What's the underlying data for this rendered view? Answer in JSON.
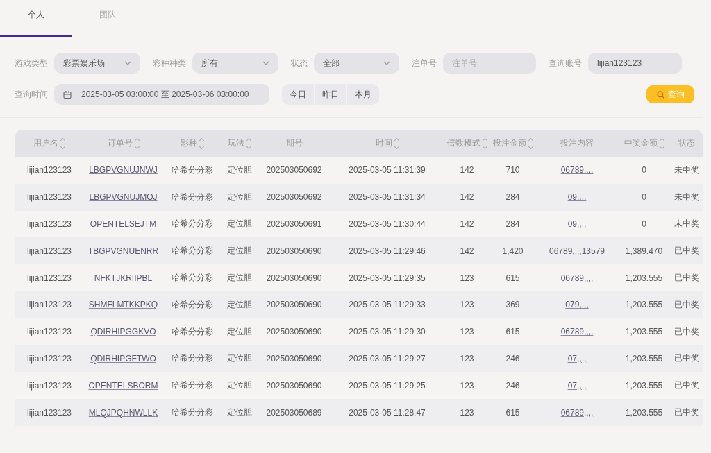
{
  "tabs": [
    {
      "label": "个人",
      "selected": true
    },
    {
      "label": "团队",
      "selected": false
    }
  ],
  "filters": [
    {
      "kind": "select",
      "label": "游戏类型",
      "value": "彩票娱乐场"
    },
    {
      "kind": "select",
      "label": "彩种种类",
      "value": "所有"
    },
    {
      "kind": "select",
      "label": "状态",
      "value": "全部"
    },
    {
      "kind": "input",
      "label": "注单号",
      "placeholder": "注单号"
    },
    {
      "kind": "input",
      "label": "查询账号",
      "value": "lijian123123"
    }
  ],
  "date_filter": {
    "label": "查询时间",
    "value": "2025-03-05 03:00:00 至 2025-03-06 03:00:00"
  },
  "quick_ranges": [
    "今日",
    "昨日",
    "本月"
  ],
  "query_button": {
    "label": "查询"
  },
  "table": {
    "columns": [
      {
        "label": "用户名",
        "sortable": true
      },
      {
        "label": "订单号",
        "sortable": true
      },
      {
        "label": "彩种",
        "sortable": true
      },
      {
        "label": "玩法",
        "sortable": true
      },
      {
        "label": "期号",
        "sortable": false
      },
      {
        "label": "时间",
        "sortable": true
      },
      {
        "label": "倍数模式",
        "sortable": true
      },
      {
        "label": "投注金额",
        "sortable": true
      },
      {
        "label": "投注内容",
        "sortable": false
      },
      {
        "label": "中奖金额",
        "sortable": true
      },
      {
        "label": "状态",
        "sortable": false
      }
    ],
    "rows": [
      [
        "lijian123123",
        "LBGPVGNUJNWJ",
        "哈希分分彩",
        "定位胆",
        "202503050692",
        "2025-03-05 11:31:39",
        "142",
        "710",
        "06789,,,,",
        "0",
        "未中奖"
      ],
      [
        "lijian123123",
        "LBGPVGNUJMOJ",
        "哈希分分彩",
        "定位胆",
        "202503050692",
        "2025-03-05 11:31:34",
        "142",
        "284",
        "09,,,,",
        "0",
        "未中奖"
      ],
      [
        "lijian123123",
        "OPENTELSEJTM",
        "哈希分分彩",
        "定位胆",
        "202503050691",
        "2025-03-05 11:30:44",
        "142",
        "284",
        "09,,,,",
        "0",
        "未中奖"
      ],
      [
        "lijian123123",
        "TBGPVGNUENRR",
        "哈希分分彩",
        "定位胆",
        "202503050690",
        "2025-03-05 11:29:46",
        "142",
        "1,420",
        "06789,,,,13579",
        "1,389.470",
        "已中奖"
      ],
      [
        "lijian123123",
        "NFKTJKRIIPBL",
        "哈希分分彩",
        "定位胆",
        "202503050690",
        "2025-03-05 11:29:35",
        "123",
        "615",
        "06789,,,,",
        "1,203.555",
        "已中奖"
      ],
      [
        "lijian123123",
        "SHMFLMTKKPKQ",
        "哈希分分彩",
        "定位胆",
        "202503050690",
        "2025-03-05 11:29:33",
        "123",
        "369",
        "079,,,,",
        "1,203.555",
        "已中奖"
      ],
      [
        "lijian123123",
        "QDIRHIPGGKVO",
        "哈希分分彩",
        "定位胆",
        "202503050690",
        "2025-03-05 11:29:30",
        "123",
        "615",
        "06789,,,,",
        "1,203.555",
        "已中奖"
      ],
      [
        "lijian123123",
        "QDIRHIPGFTWO",
        "哈希分分彩",
        "定位胆",
        "202503050690",
        "2025-03-05 11:29:27",
        "123",
        "246",
        "07,,,,",
        "1,203.555",
        "已中奖"
      ],
      [
        "lijian123123",
        "OPENTELSBORM",
        "哈希分分彩",
        "定位胆",
        "202503050690",
        "2025-03-05 11:29:25",
        "123",
        "246",
        "07,,,,",
        "1,203.555",
        "已中奖"
      ],
      [
        "lijian123123",
        "MLQJPQHNWLLK",
        "哈希分分彩",
        "定位胆",
        "202503050689",
        "2025-03-05 11:28:47",
        "123",
        "615",
        "06789,,,,",
        "1,203.555",
        "已中奖"
      ]
    ]
  }
}
